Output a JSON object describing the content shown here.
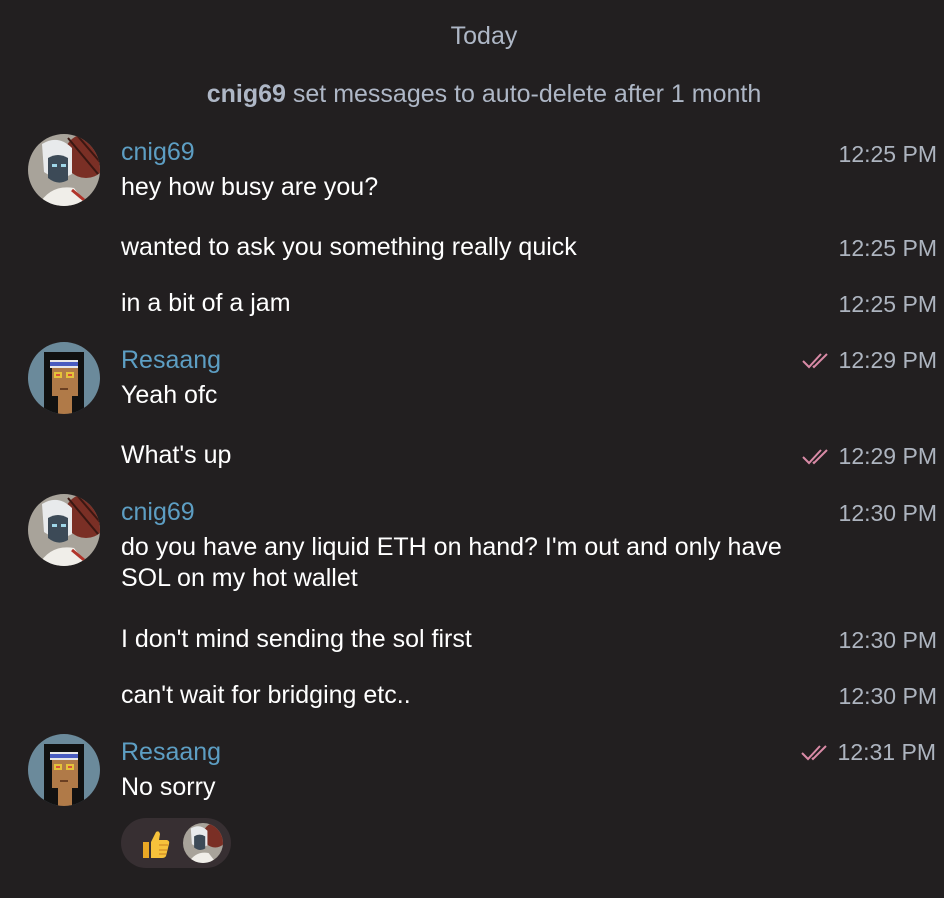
{
  "date_separator": "Today",
  "service_message": {
    "user": "cnig69",
    "text": "set messages to auto-delete after 1 month"
  },
  "groups": [
    {
      "sender": "cnig69",
      "avatar": "cnig69-avatar",
      "messages": [
        {
          "text": "hey how busy are you?",
          "time": "12:25 PM"
        },
        {
          "text": "wanted to ask you something really quick",
          "time": "12:25 PM"
        },
        {
          "text": "in a bit of a jam",
          "time": "12:25 PM"
        }
      ]
    },
    {
      "sender": "Resaang",
      "avatar": "resaang-avatar",
      "messages": [
        {
          "text": "Yeah ofc",
          "time": "12:29 PM",
          "read": true
        },
        {
          "text": "What's up",
          "time": "12:29 PM",
          "read": true
        }
      ]
    },
    {
      "sender": "cnig69",
      "avatar": "cnig69-avatar",
      "messages": [
        {
          "text": "do you have any liquid ETH on hand? I'm out and only have SOL on my hot wallet",
          "time": "12:30 PM"
        },
        {
          "text": "I don't mind sending the sol first",
          "time": "12:30 PM"
        },
        {
          "text": "can't wait for bridging etc..",
          "time": "12:30 PM"
        }
      ]
    },
    {
      "sender": "Resaang",
      "avatar": "resaang-avatar",
      "messages": [
        {
          "text": "No sorry",
          "time": "12:31 PM",
          "read": true,
          "reaction": {
            "emoji": "thumbs-up-icon",
            "by": "cnig69"
          }
        }
      ]
    }
  ],
  "colors": {
    "background": "#221f20",
    "sender_name": "#5d9ec3",
    "time": "#adb4bf",
    "read_checks": "#d98aa6",
    "reaction_bg": "#372f32"
  }
}
